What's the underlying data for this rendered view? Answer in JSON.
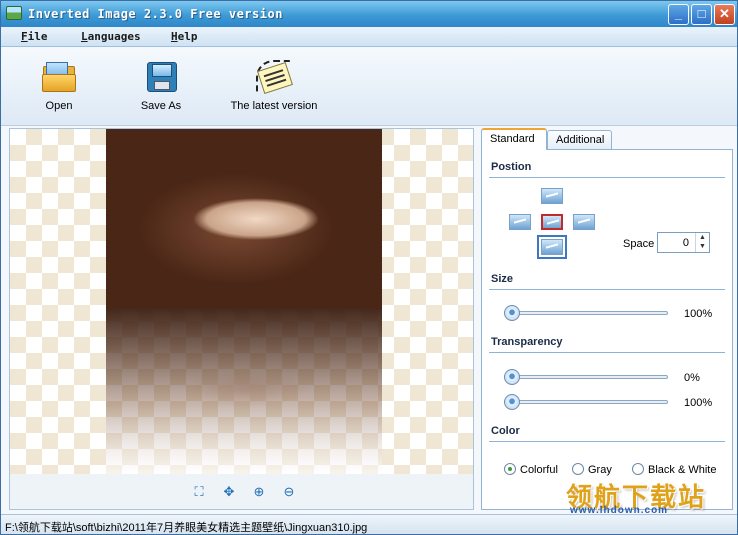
{
  "window": {
    "title": "Inverted Image 2.3.0 Free version",
    "minimize": "_",
    "maximize": "□",
    "close": "✕"
  },
  "menu": {
    "file": "File",
    "languages": "Languages",
    "help": "Help"
  },
  "toolbar": {
    "open": "Open",
    "save_as": "Save As",
    "latest": "The latest version"
  },
  "view_tools": {
    "fit": "⛶",
    "actual": "✥",
    "zoom_in": "⊕",
    "zoom_out": "⊖"
  },
  "tabs": {
    "standard": "Standard",
    "additional": "Additional"
  },
  "position": {
    "title": "Postion",
    "space_label": "Space",
    "space_value": "0",
    "spin_up": "▲",
    "spin_down": "▼"
  },
  "size": {
    "title": "Size",
    "value_label": "100%",
    "value": 1.0
  },
  "transparency": {
    "title": "Transparency",
    "start_label": "0%",
    "start_value": 0.0,
    "end_label": "100%",
    "end_value": 1.0
  },
  "color": {
    "title": "Color",
    "options": [
      "Colorful",
      "Gray",
      "Black & White"
    ],
    "selected": "Colorful"
  },
  "status": {
    "path": "F:\\领航下载站\\soft\\bizhi\\2011年7月养眼美女精选主题壁纸\\Jingxuan310.jpg"
  },
  "watermark": {
    "logo": "领航下载站",
    "url": "www.lhdown.com"
  },
  "colors": {
    "title_bar": "#3d9ad6",
    "accent_tab": "#f0a530",
    "selected_position": "#c62828"
  }
}
